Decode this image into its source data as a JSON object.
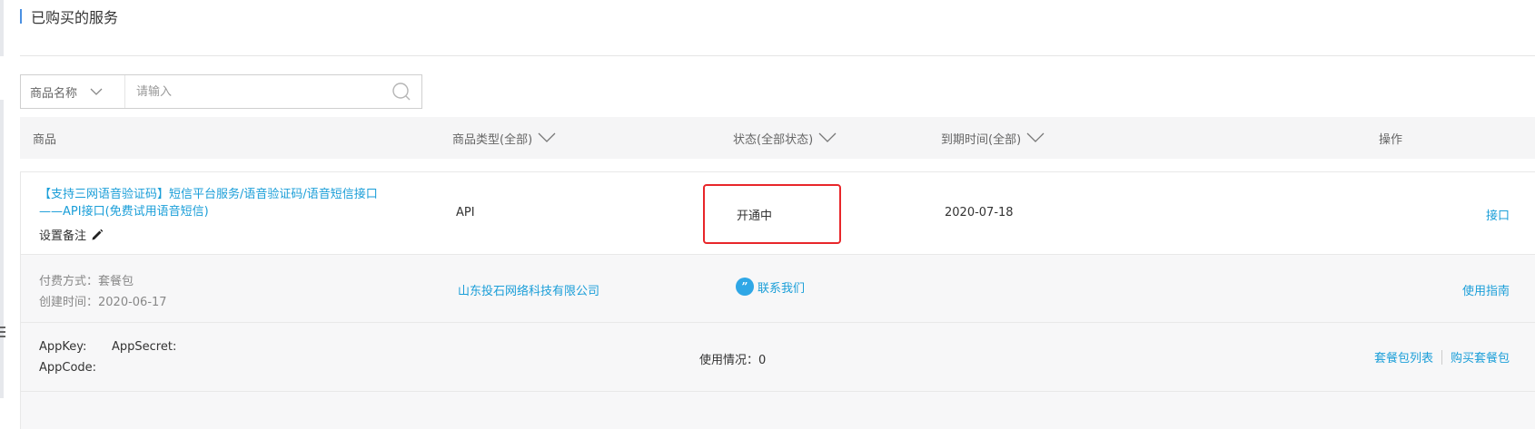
{
  "page": {
    "title": "已购买的服务"
  },
  "search": {
    "field_label": "商品名称",
    "placeholder": "请输入"
  },
  "table": {
    "columns": {
      "product": "商品",
      "type": "商品类型(全部)",
      "status": "状态(全部状态)",
      "expiry": "到期时间(全部)",
      "action": "操作"
    }
  },
  "service": {
    "name_line1": "【支持三网语音验证码】短信平台服务/语音验证码/语音短信接口",
    "name_line2": "——API接口(免费试用语音短信)",
    "remark_label": "设置备注",
    "type": "API",
    "status": "开通中",
    "expiry": "2020-07-18",
    "action_link": "接口",
    "payment": "付费方式：套餐包",
    "created": "创建时间：2020-06-17",
    "vendor": "山东投石网络科技有限公司",
    "contact": "联系我们",
    "guide": "使用指南",
    "appkey_label": "AppKey:",
    "appsecret_label": "AppSecret:",
    "appcode_label": "AppCode:",
    "usage": "使用情况：0",
    "package_list": "套餐包列表",
    "buy_package": "购买套餐包"
  },
  "icons": {
    "search": "search-icon",
    "chevron": "chevron-down-icon",
    "edit": "pencil-icon",
    "contact": "chat-bubble-icon"
  },
  "colors": {
    "link": "#1a9ed8",
    "highlight_border": "#e8262a",
    "title_accent": "#4a90e2",
    "header_bg": "#f5f5f6"
  }
}
